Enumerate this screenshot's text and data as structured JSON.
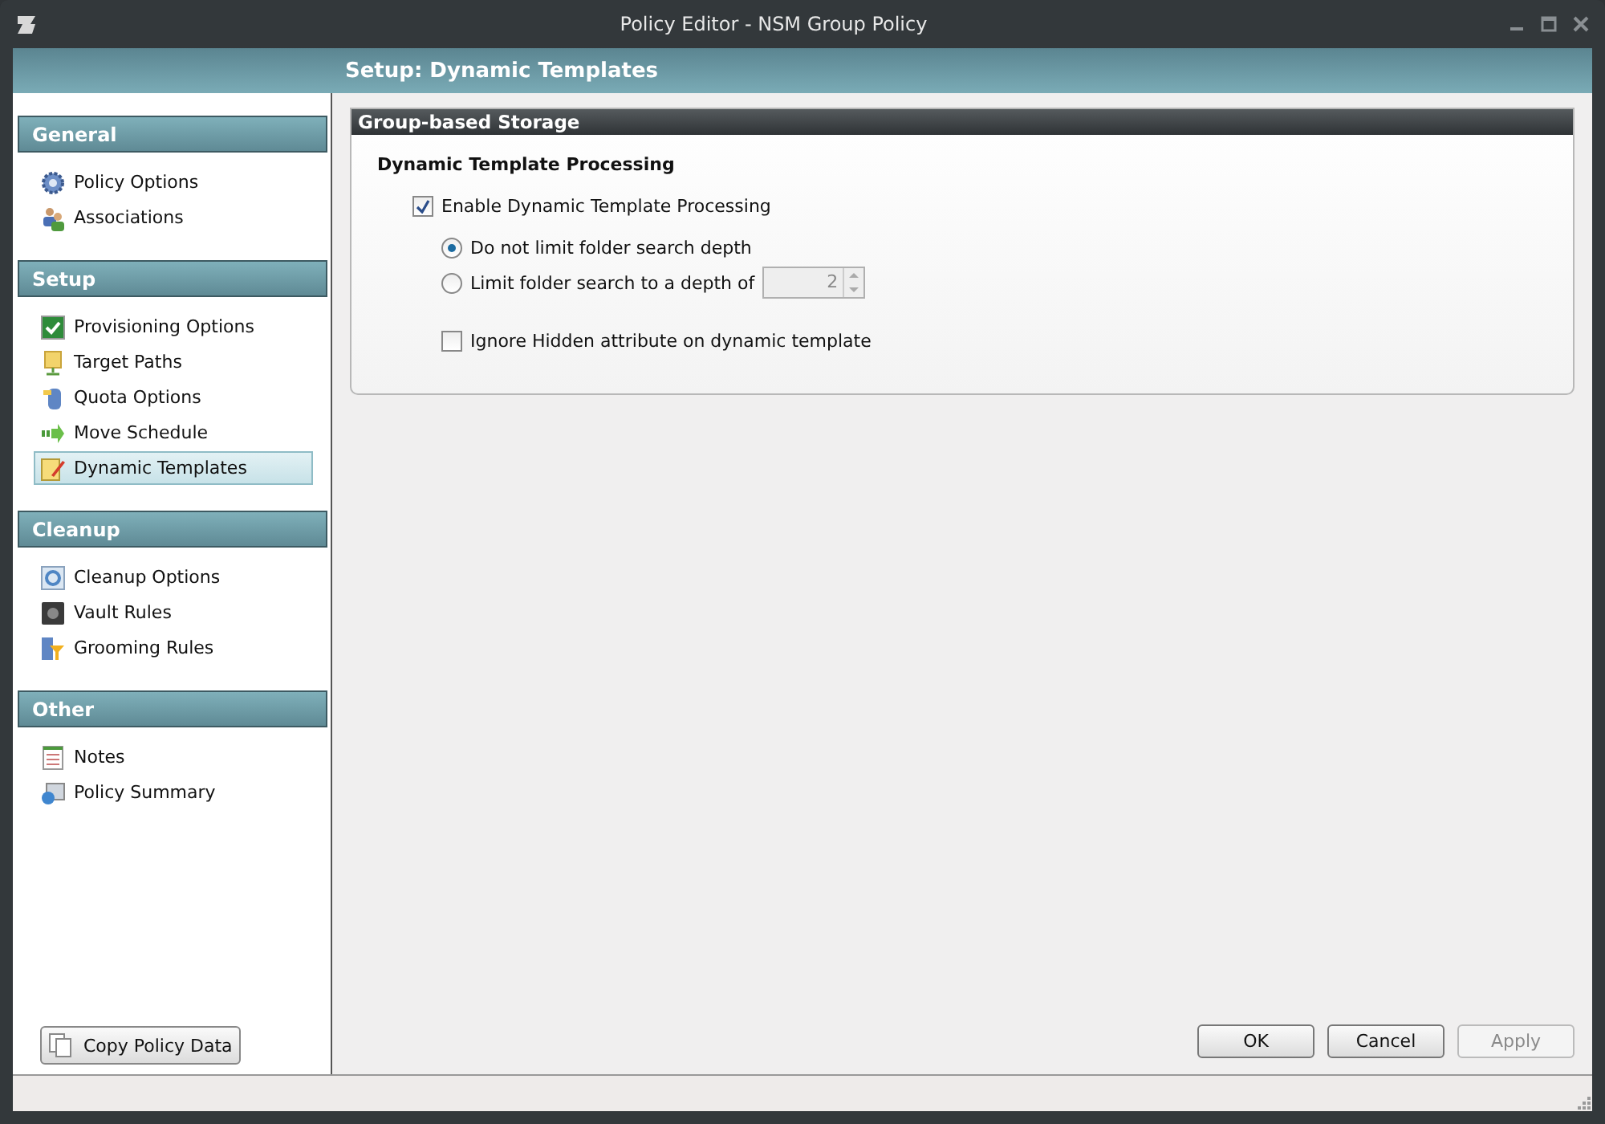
{
  "window": {
    "title": "Policy Editor - NSM Group Policy"
  },
  "header": {
    "title": "Setup: Dynamic Templates"
  },
  "sidebar": {
    "sections": [
      {
        "title": "General",
        "items": [
          {
            "label": "Policy Options",
            "selected": false
          },
          {
            "label": "Associations",
            "selected": false
          }
        ]
      },
      {
        "title": "Setup",
        "items": [
          {
            "label": "Provisioning Options",
            "selected": false
          },
          {
            "label": "Target Paths",
            "selected": false
          },
          {
            "label": "Quota Options",
            "selected": false
          },
          {
            "label": "Move Schedule",
            "selected": false
          },
          {
            "label": "Dynamic Templates",
            "selected": true
          }
        ]
      },
      {
        "title": "Cleanup",
        "items": [
          {
            "label": "Cleanup Options",
            "selected": false
          },
          {
            "label": "Vault Rules",
            "selected": false
          },
          {
            "label": "Grooming Rules",
            "selected": false
          }
        ]
      },
      {
        "title": "Other",
        "items": [
          {
            "label": "Notes",
            "selected": false
          },
          {
            "label": "Policy Summary",
            "selected": false
          }
        ]
      }
    ],
    "copy_button": "Copy Policy Data"
  },
  "panel": {
    "title": "Group-based Storage",
    "section_title": "Dynamic Template Processing",
    "enable": {
      "label": "Enable Dynamic Template Processing",
      "checked": true
    },
    "radios": [
      {
        "label": "Do not limit folder search depth",
        "selected": true
      },
      {
        "label": "Limit folder search to a depth of",
        "selected": false
      }
    ],
    "depth": {
      "value": "2",
      "disabled": true
    },
    "ignore_hidden": {
      "label": "Ignore Hidden attribute on dynamic template",
      "checked": false
    }
  },
  "buttons": [
    {
      "label": "OK",
      "disabled": false
    },
    {
      "label": "Cancel",
      "disabled": false
    },
    {
      "label": "Apply",
      "disabled": true
    }
  ]
}
